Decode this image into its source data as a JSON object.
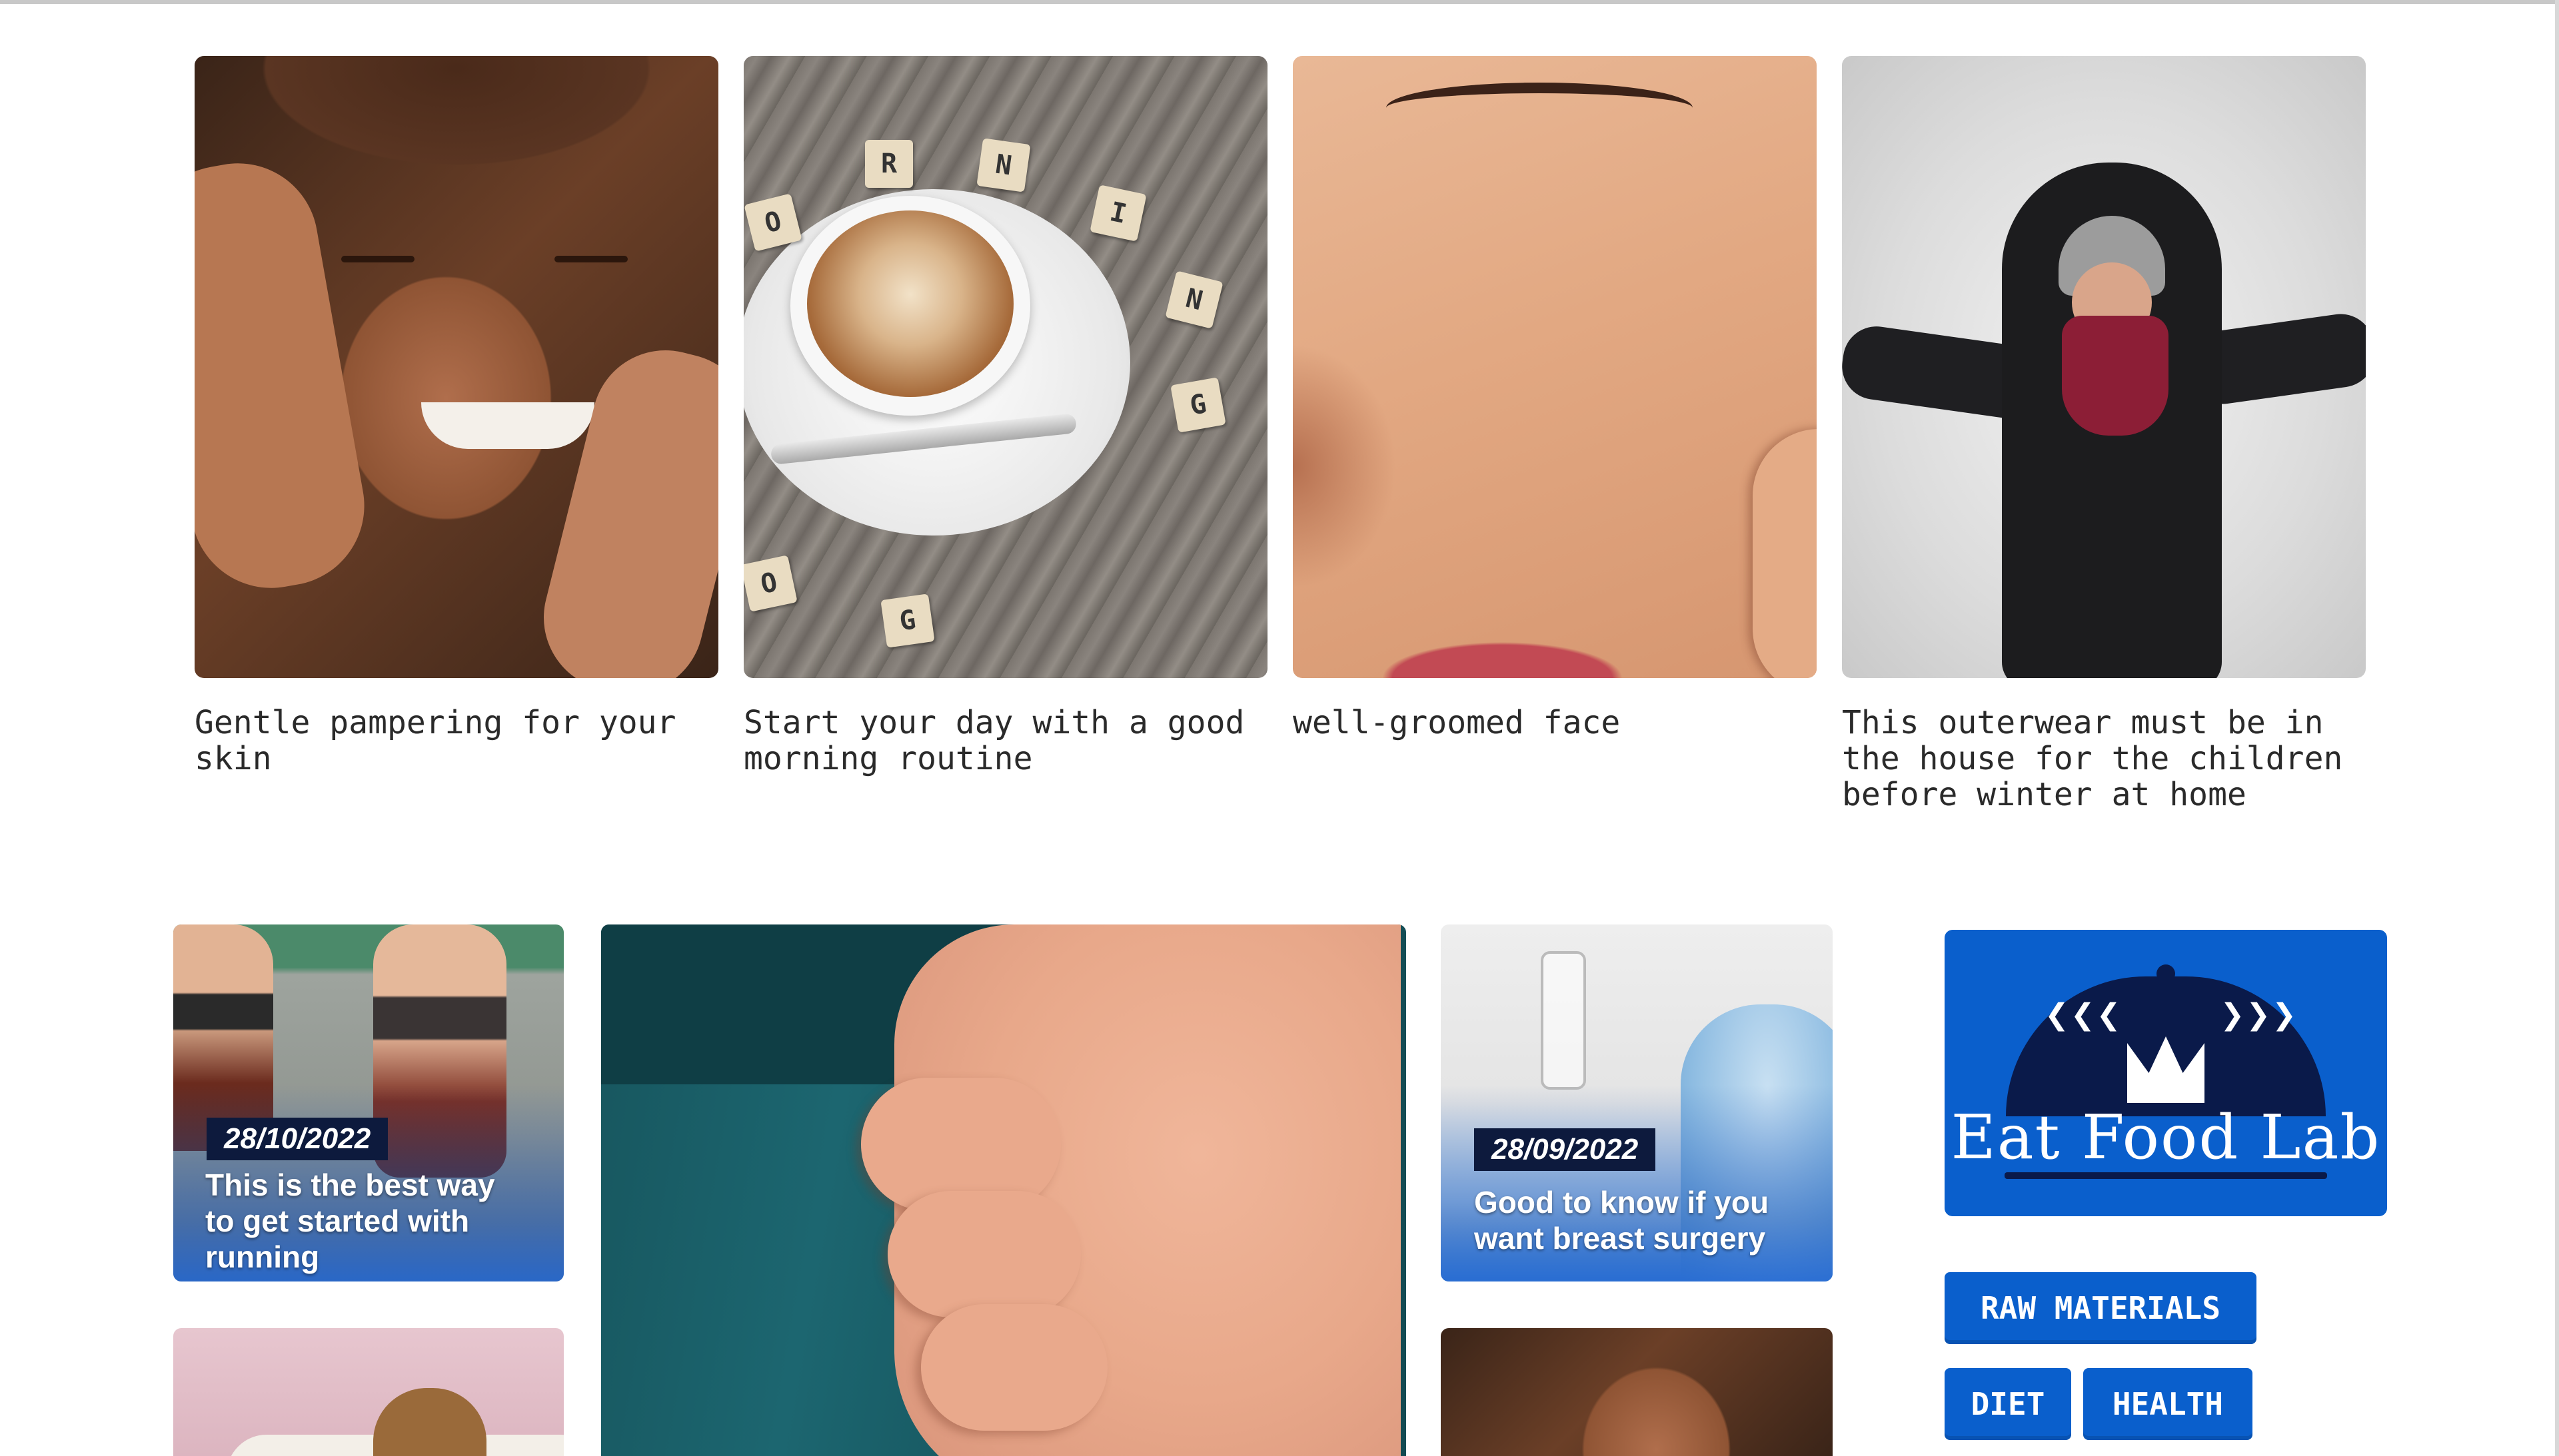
{
  "top_cards": [
    {
      "caption": "Gentle pampering for your\nskin"
    },
    {
      "caption": "Start your day with a good\nmorning routine"
    },
    {
      "caption": "well-groomed face"
    },
    {
      "caption": "This outerwear must be in\nthe house for the children\nbefore winter at home"
    }
  ],
  "coffee_tiles": [
    "R",
    "N",
    "I",
    "N",
    "G",
    "O",
    "G",
    "O"
  ],
  "posts": [
    {
      "date": "28/10/2022",
      "title": "This is the best way\nto get started with\nrunning"
    },
    {
      "date": "28/09/2022",
      "title": "Good to know if you\nwant breast surgery"
    }
  ],
  "logo": {
    "text": "Eat Food Lab"
  },
  "tags": [
    "RAW MATERIALS",
    "DIET",
    "HEALTH"
  ],
  "colors": {
    "accent": "#0a5fcc",
    "badge": "#0d1a3d",
    "logo_dark": "#0a1a4a"
  }
}
